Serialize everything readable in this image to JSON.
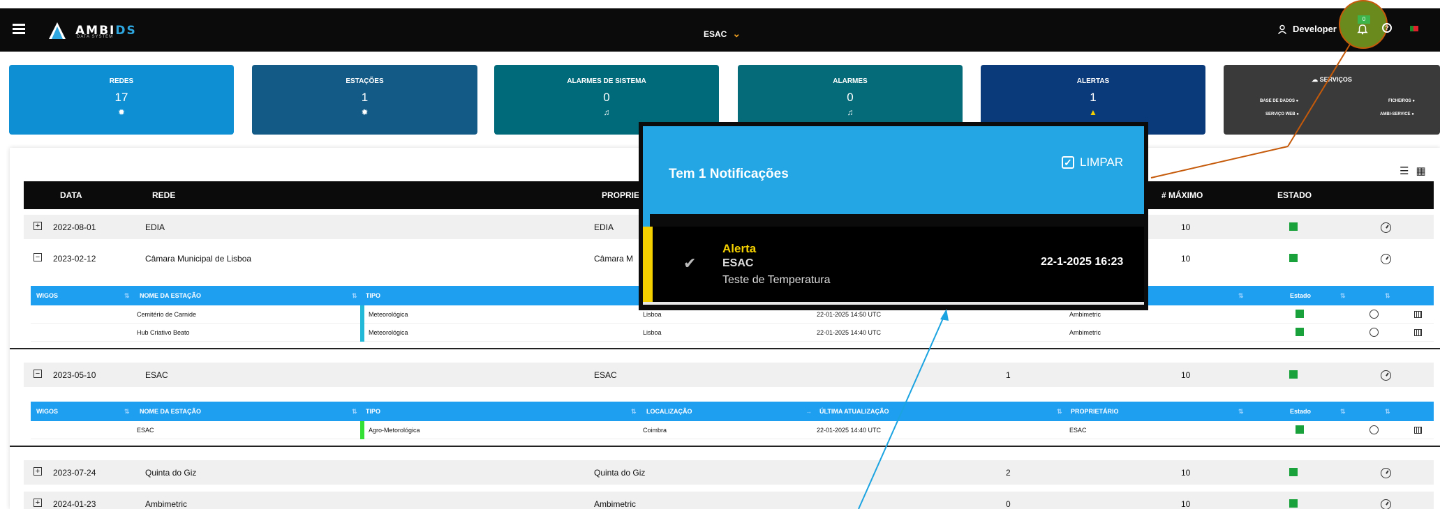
{
  "topbar": {
    "logo_main": "AMBI",
    "logo_accent": "DS",
    "logo_sub": "DATA SYSTEM",
    "station": "ESAC",
    "user": "Developer",
    "bell_count": "0",
    "help_glyph": "?"
  },
  "cards": {
    "redes": {
      "title": "REDES",
      "value": "17"
    },
    "estacoes": {
      "title": "ESTAÇÕES",
      "value": "1"
    },
    "alarmes_sistema": {
      "title": "ALARMES DE SISTEMA",
      "value": "0"
    },
    "alarmes": {
      "title": "ALARMES",
      "value": "0"
    },
    "alertas": {
      "title": "ALERTAS",
      "value": "1"
    },
    "servicos": {
      "title": "SERVIÇOS",
      "items": [
        "BASE DE DADOS",
        "FICHEIROS",
        "SERVIÇO WEB",
        "AMBI-SERVICE"
      ]
    }
  },
  "table": {
    "headers": [
      "DATA",
      "REDE",
      "PROPRIE",
      "# MÁXIMO",
      "ESTADO"
    ],
    "rows": [
      {
        "date": "2022-08-01",
        "network": "EDIA",
        "owner": "EDIA",
        "count": "",
        "max": "10",
        "toggle": "+"
      },
      {
        "date": "2023-02-12",
        "network": "Câmara Municipal de Lisboa",
        "owner": "Câmara M",
        "count": "",
        "max": "10",
        "toggle": "−"
      },
      {
        "date": "2023-05-10",
        "network": "ESAC",
        "owner": "ESAC",
        "count": "1",
        "max": "10",
        "toggle": "−"
      },
      {
        "date": "2023-07-24",
        "network": "Quinta do Giz",
        "owner": "Quinta do Giz",
        "count": "2",
        "max": "10",
        "toggle": "+"
      },
      {
        "date": "2024-01-23",
        "network": "Ambimetric",
        "owner": "Ambimetric",
        "count": "0",
        "max": "10",
        "toggle": "+"
      }
    ]
  },
  "subtable1": {
    "headers": [
      "WIGOS",
      "NOME DA ESTAÇÃO",
      "TIPO",
      "Estado"
    ],
    "rows": [
      {
        "name": "Cemitério de Carnide",
        "type": "Meteorológica",
        "location": "Lisboa",
        "updated": "22-01-2025 14:50 UTC",
        "owner": "Ambimetric"
      },
      {
        "name": "Hub Criativo Beato",
        "type": "Meteorológica",
        "location": "Lisboa",
        "updated": "22-01-2025 14:40 UTC",
        "owner": "Ambimetric"
      }
    ]
  },
  "subtable2": {
    "headers": [
      "WIGOS",
      "NOME DA ESTAÇÃO",
      "TIPO",
      "LOCALIZAÇÃO",
      "ÚLTIMA ATUALIZAÇÃO",
      "PROPRIETÁRIO",
      "Estado"
    ],
    "rows": [
      {
        "name": "ESAC",
        "type": "Agro-Metorológica",
        "location": "Coimbra",
        "updated": "22-01-2025 14:40 UTC",
        "owner": "ESAC"
      }
    ]
  },
  "notification": {
    "title": "Tem 1 Notificações",
    "clear": "LIMPAR",
    "item": {
      "type": "Alerta",
      "station": "ESAC",
      "description": "Teste de Temperatura",
      "date": "22-1-2025 16:23"
    }
  },
  "colors": {
    "annotation_orange": "#c55a0a",
    "annotation_blue": "#1aa3e0",
    "alert_yellow": "#f5d000"
  }
}
